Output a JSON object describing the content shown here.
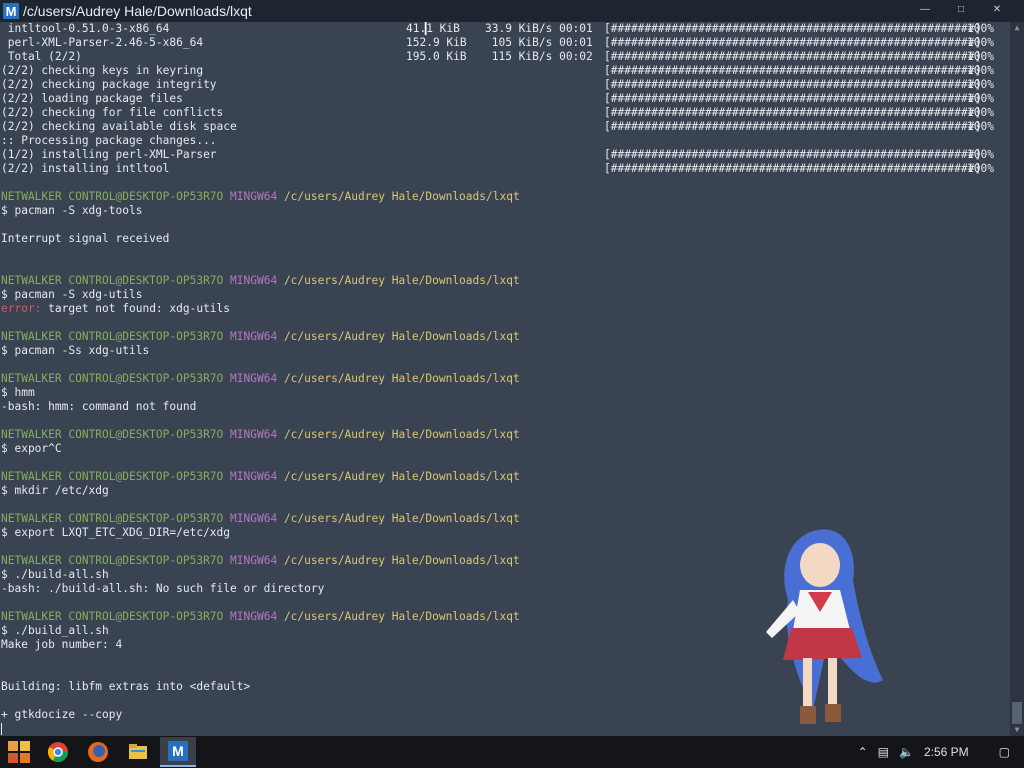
{
  "window": {
    "title": "/c/users/Audrey Hale/Downloads/lxqt",
    "icon": "msys2-icon"
  },
  "downloads": [
    {
      "name": " intltool-0.51.0-3-x86_64",
      "size": "41.1 KiB",
      "rate": "33.9 KiB/s 00:01",
      "bar": "[######################################################]",
      "pct": "100%"
    },
    {
      "name": " perl-XML-Parser-2.46-5-x86_64",
      "size": "152.9 KiB",
      "rate": " 105 KiB/s 00:01",
      "bar": "[######################################################]",
      "pct": "100%"
    },
    {
      "name": " Total (2/2)",
      "size": "195.0 KiB",
      "rate": " 115 KiB/s 00:02",
      "bar": "[######################################################]",
      "pct": "100%"
    }
  ],
  "steps": [
    {
      "text": "(2/2) checking keys in keyring",
      "bar": "[######################################################]",
      "pct": "100%"
    },
    {
      "text": "(2/2) checking package integrity",
      "bar": "[######################################################]",
      "pct": "100%"
    },
    {
      "text": "(2/2) loading package files",
      "bar": "[######################################################]",
      "pct": "100%"
    },
    {
      "text": "(2/2) checking for file conflicts",
      "bar": "[######################################################]",
      "pct": "100%"
    },
    {
      "text": "(2/2) checking available disk space",
      "bar": "[######################################################]",
      "pct": "100%"
    }
  ],
  "processing": ":: Processing package changes...",
  "installs": [
    {
      "text": "(1/2) installing perl-XML-Parser",
      "bar": "[######################################################]",
      "pct": "100%"
    },
    {
      "text": "(2/2) installing intltool",
      "bar": "[######################################################]",
      "pct": "100%"
    }
  ],
  "prompt": {
    "user": "NETWALKER CONTROL@DESKTOP-OP53R7O",
    "env": "MINGW64",
    "path": "/c/users/Audrey Hale/Downloads/lxqt"
  },
  "sessions": [
    {
      "cmd": "$ pacman -S xdg-tools",
      "out": [
        "",
        "Interrupt signal received",
        "",
        ""
      ]
    },
    {
      "cmd": "$ pacman -S xdg-utils",
      "err_label": "error:",
      "err_text": " target not found: xdg-utils",
      "out": [
        ""
      ]
    },
    {
      "cmd": "$ pacman -Ss xdg-utils",
      "out": [
        ""
      ]
    },
    {
      "cmd": "$ hmm",
      "out": [
        "-bash: hmm: command not found",
        ""
      ]
    },
    {
      "cmd": "$ expor^C",
      "out": [
        ""
      ]
    },
    {
      "cmd": "$ mkdir /etc/xdg",
      "out": [
        ""
      ]
    },
    {
      "cmd": "$ export LXQT_ETC_XDG_DIR=/etc/xdg",
      "out": [
        ""
      ]
    },
    {
      "cmd": "$ ./build-all.sh",
      "out": [
        "-bash: ./build-all.sh: No such file or directory",
        ""
      ]
    },
    {
      "cmd": "$ ./build_all.sh",
      "out": [
        "Make job number: 4",
        "",
        "",
        "Building: libfm extras into <default>",
        "",
        "+ gtkdocize --copy"
      ]
    }
  ],
  "taskbar": {
    "items": [
      {
        "name": "chrome-taskbar-icon"
      },
      {
        "name": "firefox-taskbar-icon"
      },
      {
        "name": "file-explorer-taskbar-icon"
      },
      {
        "name": "msys2-taskbar-icon"
      }
    ],
    "clock": "2:56 PM"
  },
  "colors": {
    "terminal_bg": "#3a4351",
    "prompt_user": "#86ad5c",
    "prompt_env": "#b477c2",
    "prompt_path": "#d8c672",
    "error": "#d75b54"
  }
}
